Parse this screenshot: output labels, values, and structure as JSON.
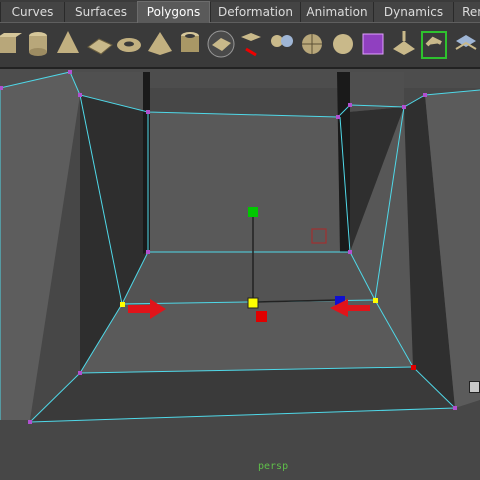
{
  "shelf_tabs": [
    {
      "label": "Curves",
      "active": false
    },
    {
      "label": "Surfaces",
      "active": false
    },
    {
      "label": "Polygons",
      "active": true
    },
    {
      "label": "Deformation",
      "active": false
    },
    {
      "label": "Animation",
      "active": false
    },
    {
      "label": "Dynamics",
      "active": false
    },
    {
      "label": "Ren",
      "active": false
    }
  ],
  "shelf_tools": [
    "poly-cube-icon",
    "poly-cylinder-icon",
    "poly-cone-icon",
    "poly-plane-icon",
    "poly-torus-icon",
    "poly-pyramid-icon",
    "poly-pipe-icon",
    "poly-plane-tool-icon",
    "split-polygon-icon",
    "combine-icon",
    "separate-icon",
    "smooth-icon",
    "poly-helix-icon",
    "extrude-icon",
    "bridge-icon",
    "append-polygon-icon"
  ],
  "viewport": {
    "camera_label": "persp",
    "wireframe_color": "#4fd8e8",
    "vertex_color": "#b050d0",
    "selected_vertex_color": "#ffff00",
    "arrow_color": "#e0141a"
  },
  "manipulator": {
    "y_handle_color": "#00c800",
    "x_handle_color": "#e00000",
    "z_handle_color": "#1010d0",
    "center_color": "#ffff00"
  }
}
